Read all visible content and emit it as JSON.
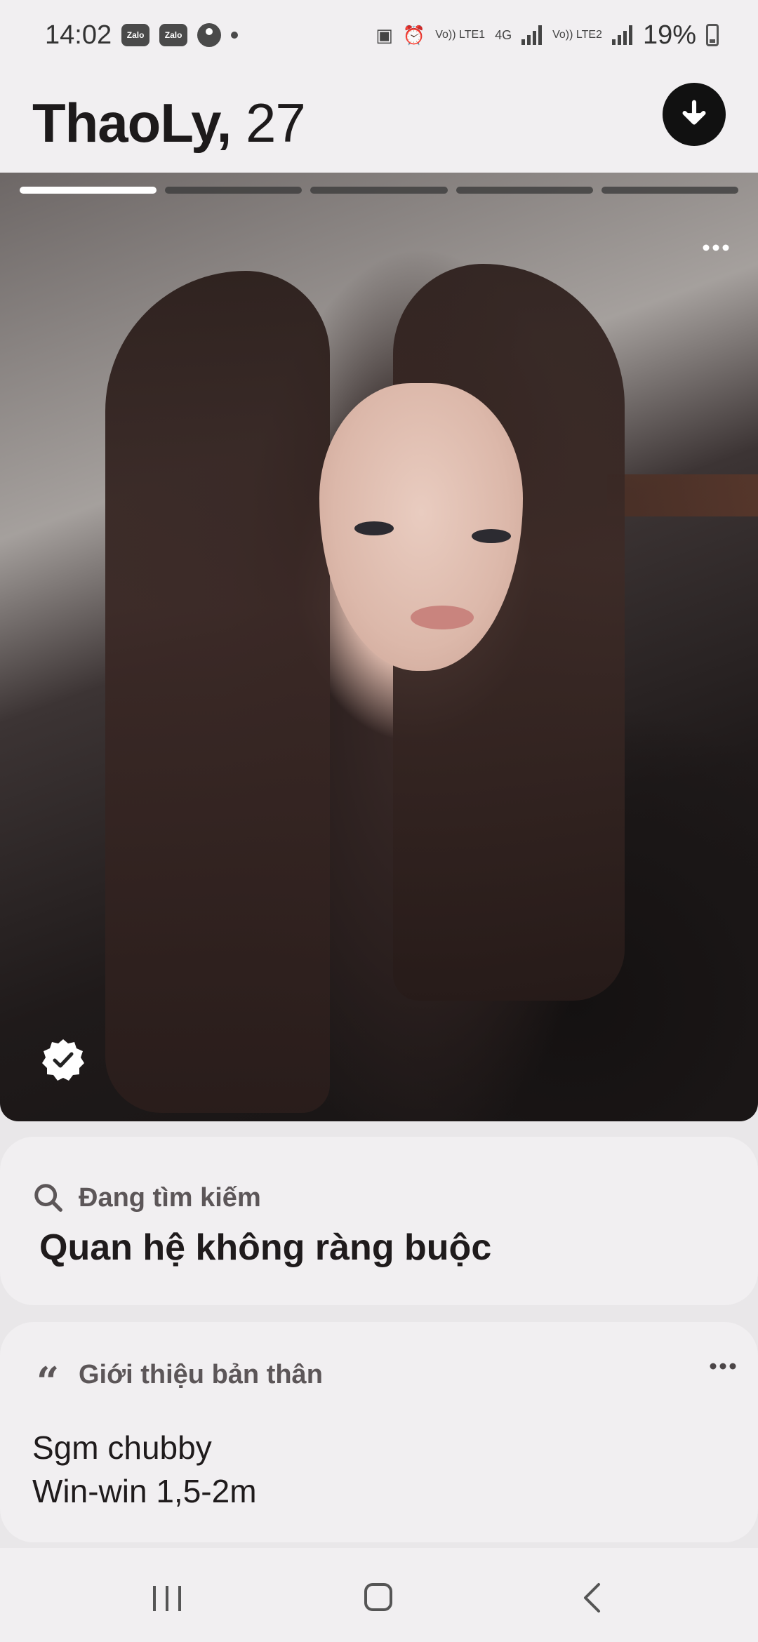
{
  "status_bar": {
    "time": "14:02",
    "notification_apps": [
      "Zalo",
      "Zalo"
    ],
    "network_labels": [
      "Vo)) LTE1",
      "4G",
      "Vo)) LTE2"
    ],
    "battery_percent": "19%"
  },
  "profile": {
    "name": "ThaoLy,",
    "age": "27"
  },
  "photo": {
    "total_photos": 5,
    "active_index": 0
  },
  "looking_for": {
    "label": "Đang tìm kiếm",
    "value": "Quan hệ không ràng buộc"
  },
  "about": {
    "label": "Giới thiệu bản thân",
    "lines": [
      "Sgm chubby",
      "Win-win 1,5-2m"
    ]
  },
  "icons": {
    "down": "arrow-down-icon",
    "verified": "verified-badge-icon",
    "search": "search-icon",
    "quote": "quote-icon",
    "more": "more-horizontal-icon"
  }
}
